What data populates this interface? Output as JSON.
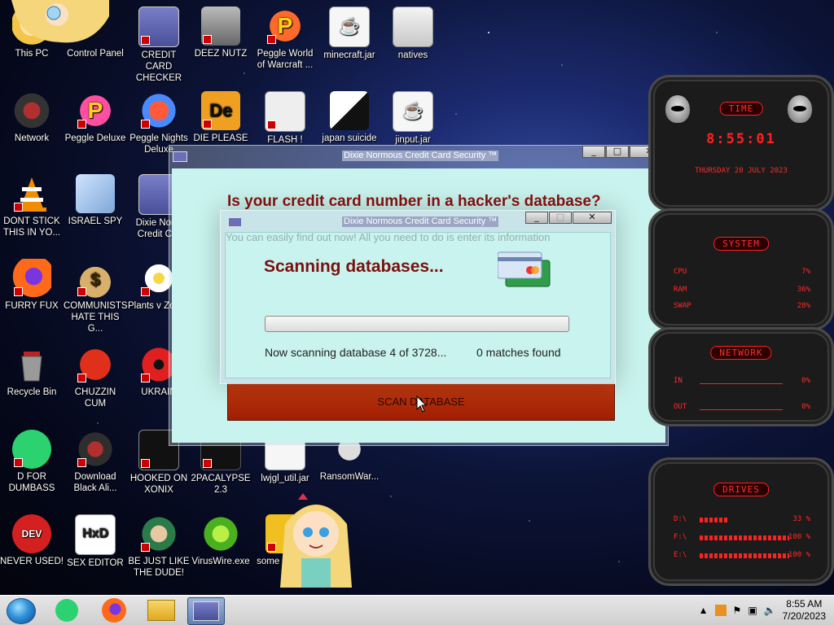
{
  "desktop_icons": [
    {
      "label": "This PC"
    },
    {
      "label": "Control Panel"
    },
    {
      "label": "CREDIT CARD CHECKER"
    },
    {
      "label": "DEEZ NUTZ"
    },
    {
      "label": "Peggle World of Warcraft ..."
    },
    {
      "label": "minecraft.jar"
    },
    {
      "label": "natives"
    },
    {
      "label": "Network"
    },
    {
      "label": "Peggle Deluxe"
    },
    {
      "label": "Peggle Nights Deluxe"
    },
    {
      "label": "DIE PLEASE"
    },
    {
      "label": "FLASH !"
    },
    {
      "label": "japan suicide"
    },
    {
      "label": "jinput.jar"
    },
    {
      "label": "DONT STICK THIS IN YO..."
    },
    {
      "label": "ISRAEL SPY"
    },
    {
      "label": "Dixie Norm Credit Car"
    },
    {
      "label": "FURRY FUX"
    },
    {
      "label": "COMMUNISTS HATE THIS G..."
    },
    {
      "label": "Plants v Zombi"
    },
    {
      "label": "Recycle Bin"
    },
    {
      "label": "CHUZZIN CUM"
    },
    {
      "label": "UKRAIN"
    },
    {
      "label": "D FOR DUMBASS"
    },
    {
      "label": "Download Black Ali..."
    },
    {
      "label": "HOOKED ON XONIX"
    },
    {
      "label": "2PACALYPSE 2.3"
    },
    {
      "label": "lwjgl_util.jar"
    },
    {
      "label": "RansomWar..."
    },
    {
      "label": "NEVER USED!"
    },
    {
      "label": "SEX EDITOR"
    },
    {
      "label": "BE JUST LIKE THE DUDE!"
    },
    {
      "label": "VirusWire.exe"
    },
    {
      "label": "some need to"
    }
  ],
  "main_window": {
    "title": "Dixie Normous Credit Card Security ™",
    "headline": "Is your credit card number in a hacker's database?",
    "scan_button": "SCAN DATABASE"
  },
  "progress_window": {
    "title": "Dixie Normous Credit Card Security ™",
    "background_text": "You can easily find out now! All you need to do is enter its information",
    "scan_title": "Scanning databases...",
    "progress": 0,
    "status": "Now scanning database 4 of 3728...",
    "matches": "0 matches found"
  },
  "hud": {
    "time": {
      "title": "TIME",
      "clock": "8:55:01",
      "date": "THURSDAY 20 JULY 2023"
    },
    "system": {
      "title": "SYSTEM",
      "rows": [
        {
          "label": "CPU",
          "value": "7%"
        },
        {
          "label": "RAM",
          "value": "36%"
        },
        {
          "label": "SWAP",
          "value": "28%"
        }
      ]
    },
    "network": {
      "title": "NETWORK",
      "rows": [
        {
          "label": "IN",
          "value": "0%"
        },
        {
          "label": "OUT",
          "value": "0%"
        }
      ]
    },
    "drives": {
      "title": "DRIVES",
      "rows": [
        {
          "label": "D:\\",
          "value": "33 %"
        },
        {
          "label": "F:\\",
          "value": "100 %"
        },
        {
          "label": "E:\\",
          "value": "100 %"
        }
      ]
    }
  },
  "taskbar": {
    "time": "8:55 AM",
    "date": "7/20/2023"
  }
}
